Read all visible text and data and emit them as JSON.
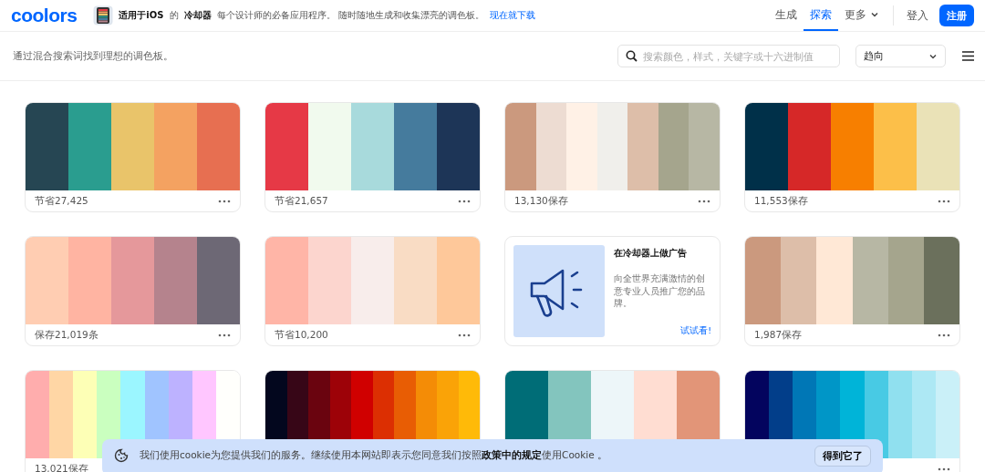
{
  "header": {
    "logo": "coolors",
    "promo": {
      "platform": "适用于iOS",
      "of": "的",
      "app": "冷却器",
      "text": "每个设计师的必备应用程序。 随时随地生成和收集漂亮的调色板。",
      "link": "现在就下载"
    },
    "nav": [
      {
        "label": "生成",
        "selected": false,
        "dropdown": false
      },
      {
        "label": "探索",
        "selected": true,
        "dropdown": false
      },
      {
        "label": "更多",
        "selected": false,
        "dropdown": true
      }
    ],
    "login": "登入",
    "signup": "注册"
  },
  "toolbar": {
    "hint": "通过混合搜索词找到理想的调色板。",
    "search": {
      "placeholder": "搜索颜色，样式，关键字或十六进制值"
    },
    "sort": "趋向"
  },
  "palettes": [
    {
      "kind": "palette",
      "colors": [
        {
          "color": "#264653"
        },
        {
          "color": "#2a9d8f"
        },
        {
          "color": "#e9c46a"
        },
        {
          "color": "#f4a261"
        },
        {
          "color": "#e76f51"
        }
      ],
      "label": "节省27,425",
      "menu": true
    },
    {
      "kind": "palette",
      "colors": [
        {
          "color": "#e63946"
        },
        {
          "color": "#f1faee"
        },
        {
          "color": "#a8dadc"
        },
        {
          "color": "#457b9d"
        },
        {
          "color": "#1d3557"
        }
      ],
      "label": "节省21,657",
      "menu": true
    },
    {
      "kind": "palette",
      "colors": [
        {
          "color": "#cb997e"
        },
        {
          "color": "#eddcd2"
        },
        {
          "color": "#fff1e6"
        },
        {
          "color": "#f0efeb"
        },
        {
          "color": "#ddbea9"
        },
        {
          "color": "#a5a58d"
        },
        {
          "color": "#b7b7a4"
        }
      ],
      "label": "13,130保存",
      "menu": true
    },
    {
      "kind": "palette",
      "colors": [
        {
          "color": "#003049"
        },
        {
          "color": "#d62828"
        },
        {
          "color": "#f77f00"
        },
        {
          "color": "#fcbf49"
        },
        {
          "color": "#eae2b7"
        }
      ],
      "label": "11,553保存",
      "menu": true
    },
    {
      "kind": "palette",
      "colors": [
        {
          "color": "#ffcdb2"
        },
        {
          "color": "#ffb4a2"
        },
        {
          "color": "#e5989b"
        },
        {
          "color": "#b5838d"
        },
        {
          "color": "#6d6875"
        }
      ],
      "label": "保存21,019条",
      "menu": true
    },
    {
      "kind": "palette",
      "colors": [
        {
          "color": "#ffb5a7"
        },
        {
          "color": "#fcd5ce"
        },
        {
          "color": "#f8edeb"
        },
        {
          "color": "#f9dcc4"
        },
        {
          "color": "#fec89a"
        }
      ],
      "label": "节省10,200",
      "menu": true
    },
    {
      "kind": "ad",
      "title": "在冷却器上做广告",
      "text": "向全世界充满激情的创意专业人员推广您的品牌。",
      "link": "试试看!"
    },
    {
      "kind": "palette",
      "colors": [
        {
          "color": "#cb997e"
        },
        {
          "color": "#ddbea9"
        },
        {
          "color": "#ffe8d6"
        },
        {
          "color": "#b7b7a4"
        },
        {
          "color": "#a5a58d"
        },
        {
          "color": "#6b705c"
        }
      ],
      "label": "1,987保存",
      "menu": true
    },
    {
      "kind": "palette",
      "colors": [
        {
          "color": "#ffadad"
        },
        {
          "color": "#ffd6a5"
        },
        {
          "color": "#fdffb6"
        },
        {
          "color": "#caffbf"
        },
        {
          "color": "#9bf6ff"
        },
        {
          "color": "#a0c4ff"
        },
        {
          "color": "#bdb2ff"
        },
        {
          "color": "#ffc6ff"
        },
        {
          "color": "#fffffc"
        }
      ],
      "label": "13,021保存",
      "menu": false
    },
    {
      "kind": "palette",
      "colors": [
        {
          "color": "#03071e"
        },
        {
          "color": "#370617"
        },
        {
          "color": "#6a040f"
        },
        {
          "color": "#9d0208"
        },
        {
          "color": "#d00000"
        },
        {
          "color": "#dc2f02"
        },
        {
          "color": "#e85d04"
        },
        {
          "color": "#f48c06"
        },
        {
          "color": "#faa307"
        },
        {
          "color": "#ffba08"
        }
      ],
      "menu": false
    },
    {
      "kind": "palette",
      "colors": [
        {
          "color": "#006d77"
        },
        {
          "color": "#83c5be"
        },
        {
          "color": "#edf6f9"
        },
        {
          "color": "#ffddd2"
        },
        {
          "color": "#e29578"
        }
      ],
      "menu": false
    },
    {
      "kind": "palette",
      "colors": [
        {
          "color": "#03045e"
        },
        {
          "color": "#023e8a"
        },
        {
          "color": "#0077b6"
        },
        {
          "color": "#0096c7"
        },
        {
          "color": "#00b4d8"
        },
        {
          "color": "#48cae4"
        },
        {
          "color": "#90e0ef"
        },
        {
          "color": "#ade8f4"
        },
        {
          "color": "#caf0f8"
        }
      ],
      "menu": true
    }
  ],
  "cookie": {
    "text": "我们使用cookie为您提供我们的服务。继续使用本网站即表示您同意我们按照**政策中的规定**使用Cookie 。",
    "button": "得到它了"
  }
}
